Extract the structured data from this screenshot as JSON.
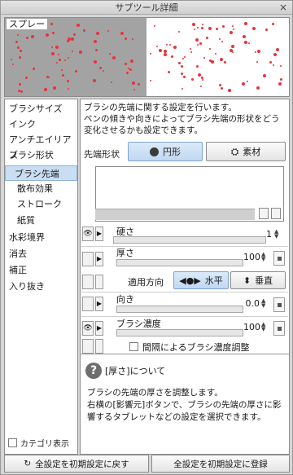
{
  "window": {
    "title": "サブツール詳細",
    "close": "×"
  },
  "preview": {
    "label": "スプレー"
  },
  "sidebar": {
    "items": [
      {
        "label": "ブラシサイズ"
      },
      {
        "label": "インク"
      },
      {
        "label": "アンチエイリアス"
      },
      {
        "label": "ブラシ形状"
      },
      {
        "label": "ブラシ先端"
      },
      {
        "label": "散布効果"
      },
      {
        "label": "ストローク"
      },
      {
        "label": "紙質"
      },
      {
        "label": "水彩境界"
      },
      {
        "label": "消去"
      },
      {
        "label": "補正"
      },
      {
        "label": "入り抜き"
      }
    ],
    "show_category_label": "カテゴリ表示"
  },
  "main": {
    "description": [
      "ブラシの先端に関する設定を行います。",
      "ペンの傾きや向きによってブラシ先端の形状をどう",
      "変化させるかも設定できます。"
    ],
    "tip_shape_label": "先端形状",
    "tip_circle_label": "円形",
    "tip_material_label": "素材",
    "hardness": {
      "label": "硬さ",
      "value": "1"
    },
    "thickness": {
      "label": "厚さ",
      "value": "100"
    },
    "apply_direction": {
      "label": "適用方向",
      "horizontal": "水平",
      "vertical": "垂直"
    },
    "direction": {
      "label": "向き",
      "value": "0.0"
    },
    "brush_density": {
      "label": "ブラシ濃度",
      "value": "100"
    },
    "interval_density_label": "間隔によるブラシ濃度調整"
  },
  "help": {
    "title": "[厚さ]について",
    "body": [
      "ブラシの先端の厚さを調整します。",
      "右横の[影響元]ボタンで、ブラシの先端の厚さに影",
      "響するタブレットなどの設定を選択できます。"
    ]
  },
  "footer": {
    "reset_label": "全設定を初期設定に戻す",
    "register_label": "全設定を初期設定に登録"
  },
  "colors": {
    "spray": "#e8333a",
    "selection": "#c9ddf3"
  }
}
